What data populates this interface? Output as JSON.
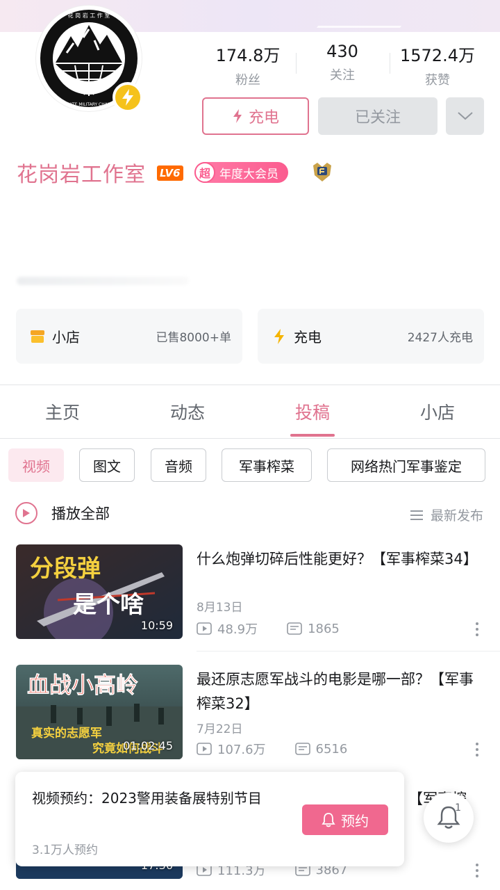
{
  "profile": {
    "name": "花岗岩工作室",
    "level": "LV6",
    "vip_prefix": "超",
    "vip_label": "年度大会员",
    "avatar_ring_text": "花 岗 岩 工 作 室",
    "avatar_lower_text": "GRANITE MILITARY CHANNEL"
  },
  "stats": [
    {
      "value": "174.8万",
      "label": "粉丝"
    },
    {
      "value": "430",
      "label": "关注"
    },
    {
      "value": "1572.4万",
      "label": "获赞"
    }
  ],
  "actions": {
    "charge": "充电",
    "followed": "已关注"
  },
  "cards": {
    "shop": {
      "title": "小店",
      "meta": "已售8000+单"
    },
    "charge": {
      "title": "充电",
      "meta": "2427人充电"
    }
  },
  "tabs": [
    "主页",
    "动态",
    "投稿",
    "小店"
  ],
  "chips": [
    "视频",
    "图文",
    "音频",
    "军事榨菜",
    "网络热门军事鉴定"
  ],
  "list": {
    "play_all": "播放全部",
    "sort": "最新发布"
  },
  "videos": [
    {
      "title": "什么炮弹切碎后性能更好？【军事榨菜34】",
      "date": "8月13日",
      "views": "48.9万",
      "comments": "1865",
      "duration": "10:59",
      "thumb_text_1": "分段弹",
      "thumb_text_2": "是个啥"
    },
    {
      "title": "最还原志愿军战斗的电影是哪一部？【军事榨菜32】",
      "date": "7月22日",
      "views": "107.6万",
      "comments": "6516",
      "duration": "01:02:45",
      "thumb_text_1": "血战小高岭",
      "thumb_text_2": "真实的志愿军",
      "thumb_text_3": "究竟如何战斗"
    },
    {
      "title": "【军事榨",
      "views": "111.3万",
      "comments": "3867",
      "duration": "17:36"
    }
  ],
  "popup": {
    "title": "视频预约：2023警用装备展特别节目",
    "sub": "3.1万人预约",
    "button": "预约"
  },
  "bell_count": "1",
  "colors": {
    "accent": "#e0738f",
    "brand_pink": "#fb5c8f",
    "gray_text": "#9499a0"
  }
}
